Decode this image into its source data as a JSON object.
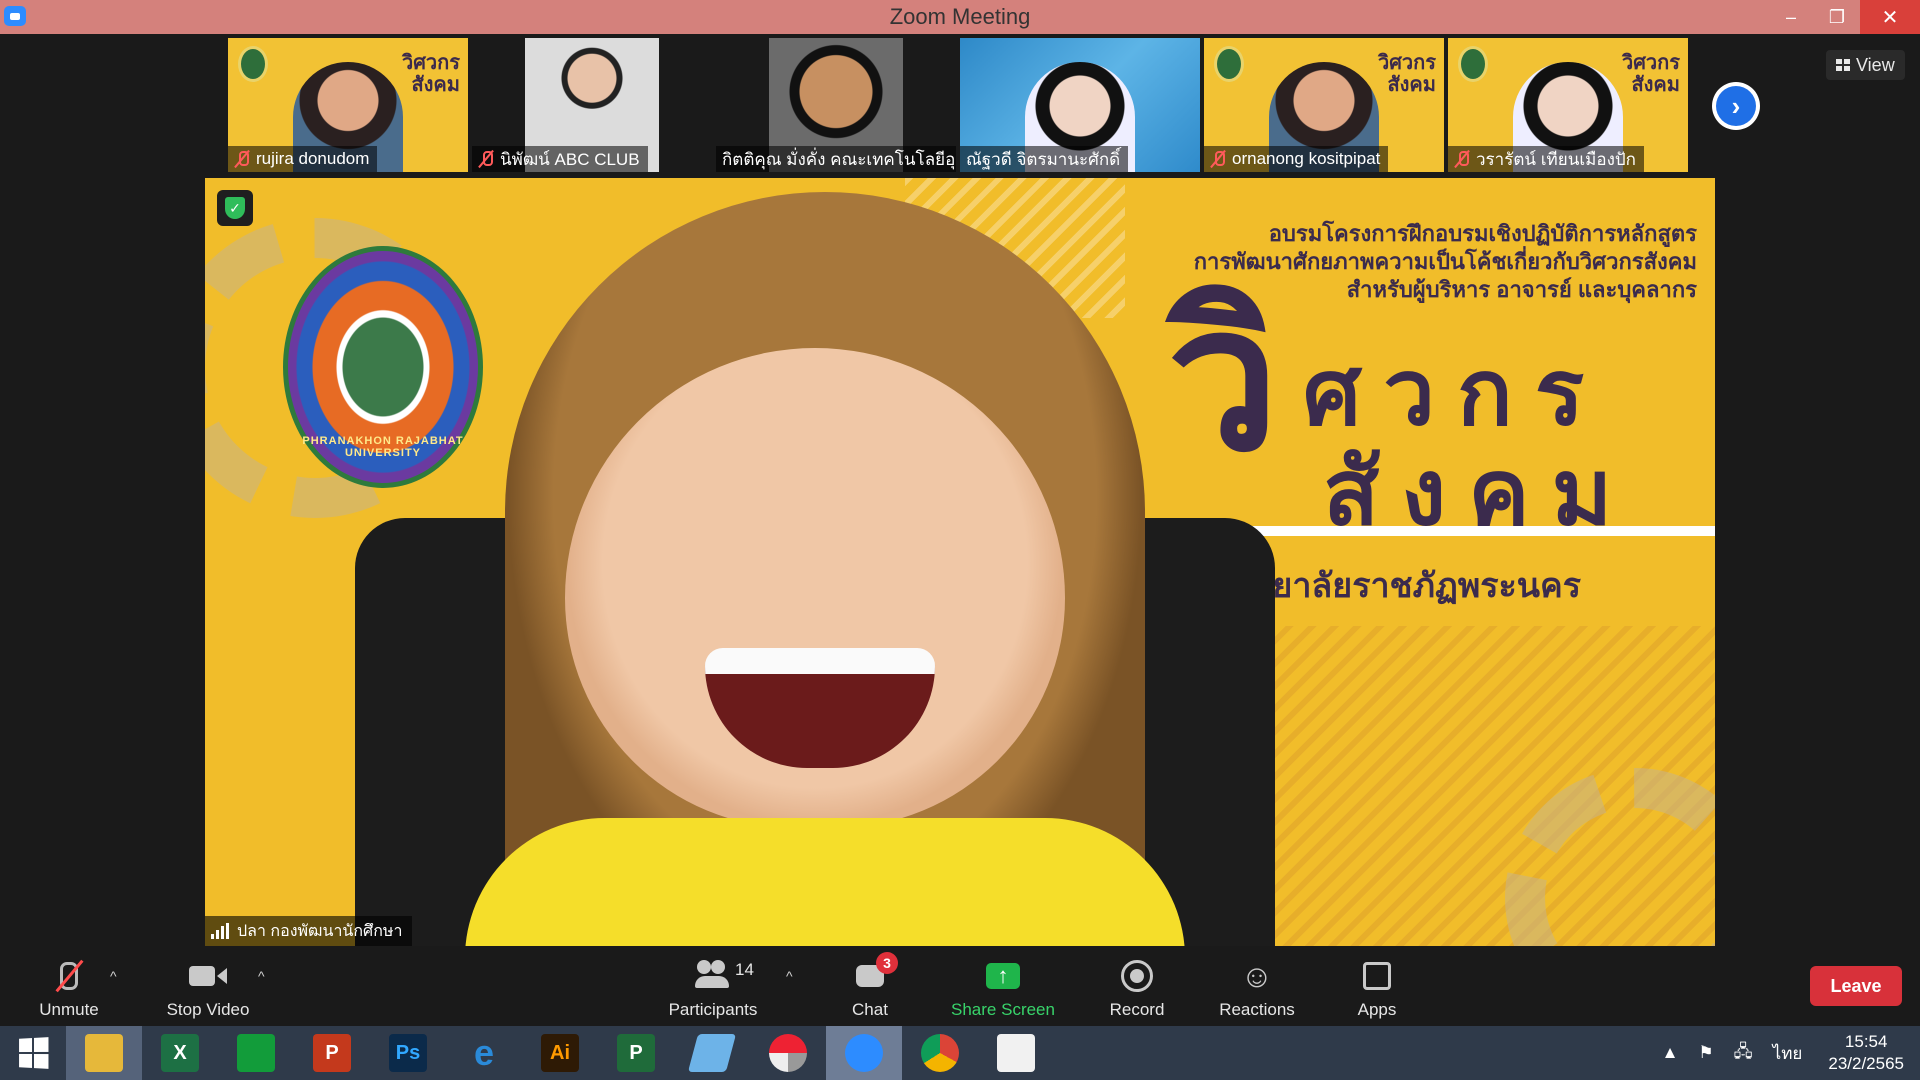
{
  "window": {
    "title": "Zoom Meeting",
    "minimize_label": "–",
    "restore_label": "❐",
    "close_label": "✕"
  },
  "gallery": {
    "tiles": [
      {
        "name": "rujira donudom",
        "muted": true,
        "tile_text": "วิศวกร\nสังคม"
      },
      {
        "name": "นิพัฒน์ ABC CLUB",
        "muted": true
      },
      {
        "name": "กิตติคุณ มั่งคั่ง คณะเทคโนโลยีอุ..."
      },
      {
        "name": "ณัฐวดี จิตรมานะศักดิ์"
      },
      {
        "name": "ornanong kositpipat",
        "muted": true,
        "tile_text": "วิศวกร\nสังคม"
      },
      {
        "name": "วรารัตน์ เทียนเมืองปัก",
        "muted": true,
        "tile_text": "วิศวกร\nสังคม"
      }
    ],
    "next_label": "›",
    "view_label": "View"
  },
  "main_video": {
    "banner_line1": "อบรมโครงการฝึกอบรมเชิงปฏิบัติการหลักสูตร",
    "banner_line2": "การพัฒนาศักยภาพความเป็นโค้ชเกี่ยวกับวิศวกรสังคม",
    "banner_line3": "สำหรับผู้บริหาร อาจารย์ และบุคลากร",
    "big_vi": "วิ",
    "word_line1": "ศวกร",
    "word_line2": "สังคม",
    "university": "มหาวิทยาลัยราชภัฏพระนคร",
    "seal_text": "PHRANAKHON RAJABHAT UNIVERSITY",
    "speaker_name": "ปลา กองพัฒนานักศึกษา",
    "shield_glyph": "✓"
  },
  "controls": {
    "unmute": "Unmute",
    "stop_video": "Stop Video",
    "participants": "Participants",
    "participants_count": "14",
    "chat": "Chat",
    "chat_badge": "3",
    "share_screen": "Share Screen",
    "record": "Record",
    "reactions": "Reactions",
    "apps": "Apps",
    "leave": "Leave",
    "caret": "^"
  },
  "taskbar": {
    "apps": [
      {
        "id": "file-explorer",
        "label": "",
        "color": "#e6b83a"
      },
      {
        "id": "excel",
        "label": "X",
        "color": "#1d7044"
      },
      {
        "id": "publisher-green",
        "label": "",
        "color": "#129c3a"
      },
      {
        "id": "powerpoint",
        "label": "P",
        "color": "#c4391c"
      },
      {
        "id": "photoshop",
        "label": "Ps",
        "color": "#0b2a4a"
      },
      {
        "id": "internet-explorer",
        "label": "e",
        "color": "#2a8ad9"
      },
      {
        "id": "illustrator",
        "label": "Ai",
        "color": "#2e1a05"
      },
      {
        "id": "project",
        "label": "P",
        "color": "#1f6b3a"
      },
      {
        "id": "pen-tool",
        "label": "",
        "color": "#6db3e8"
      },
      {
        "id": "photoscape",
        "label": "",
        "color": "#4a4a4a"
      },
      {
        "id": "zoom",
        "label": "",
        "color": "#2d8cff"
      },
      {
        "id": "chrome",
        "label": "",
        "color": "#e0463a"
      },
      {
        "id": "paint",
        "label": "",
        "color": "#f1f1f1"
      }
    ],
    "tray_arrow": "▲",
    "language": "ไทย",
    "time": "15:54",
    "date": "23/2/2565"
  }
}
